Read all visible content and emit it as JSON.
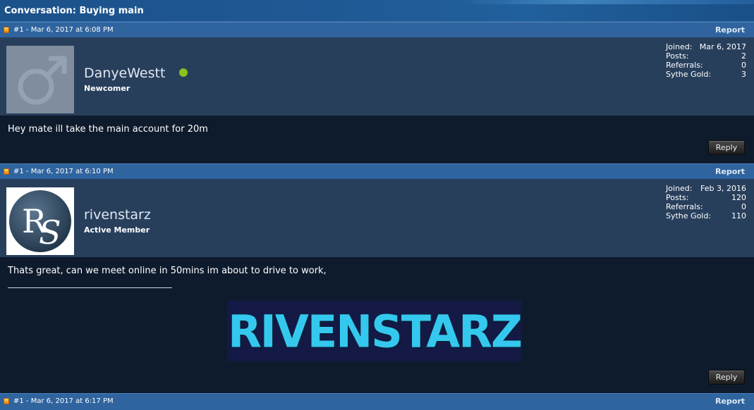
{
  "conversation": {
    "title": "Conversation: Buying main"
  },
  "messages": [
    {
      "meta": "#1 - Mar 6, 2017 at 6:08 PM",
      "report_label": "Report",
      "user": {
        "name": "DanyeWestt",
        "rank": "Newcomer",
        "online": true,
        "stats": [
          {
            "label": "Joined:",
            "value": "Mar 6, 2017"
          },
          {
            "label": "Posts:",
            "value": "2"
          },
          {
            "label": "Referrals:",
            "value": "0"
          },
          {
            "label": "Sythe Gold:",
            "value": "3"
          }
        ]
      },
      "body": "Hey mate ill take the main account for 20m",
      "reply_label": "Reply"
    },
    {
      "meta": "#1 - Mar 6, 2017 at 6:10 PM",
      "report_label": "Report",
      "user": {
        "name": "rivenstarz",
        "rank": "Active Member",
        "stats": [
          {
            "label": "Joined:",
            "value": "Feb 3, 2016"
          },
          {
            "label": "Posts:",
            "value": "120"
          },
          {
            "label": "Referrals:",
            "value": "0"
          },
          {
            "label": "Sythe Gold:",
            "value": "110"
          }
        ]
      },
      "body": "Thats great, can we meet online in 50mins im about to drive to work,",
      "signature_banner": "RIVENSTARZ",
      "reply_label": "Reply"
    },
    {
      "meta": "#1 - Mar 6, 2017 at 6:17 PM",
      "report_label": "Report"
    }
  ],
  "colors": {
    "header_blue": "#2f649f",
    "user_panel": "#283f5c",
    "page_bg": "#0e1b2d",
    "online_green": "#8cc01c",
    "banner_cyan": "#35c8ee"
  }
}
